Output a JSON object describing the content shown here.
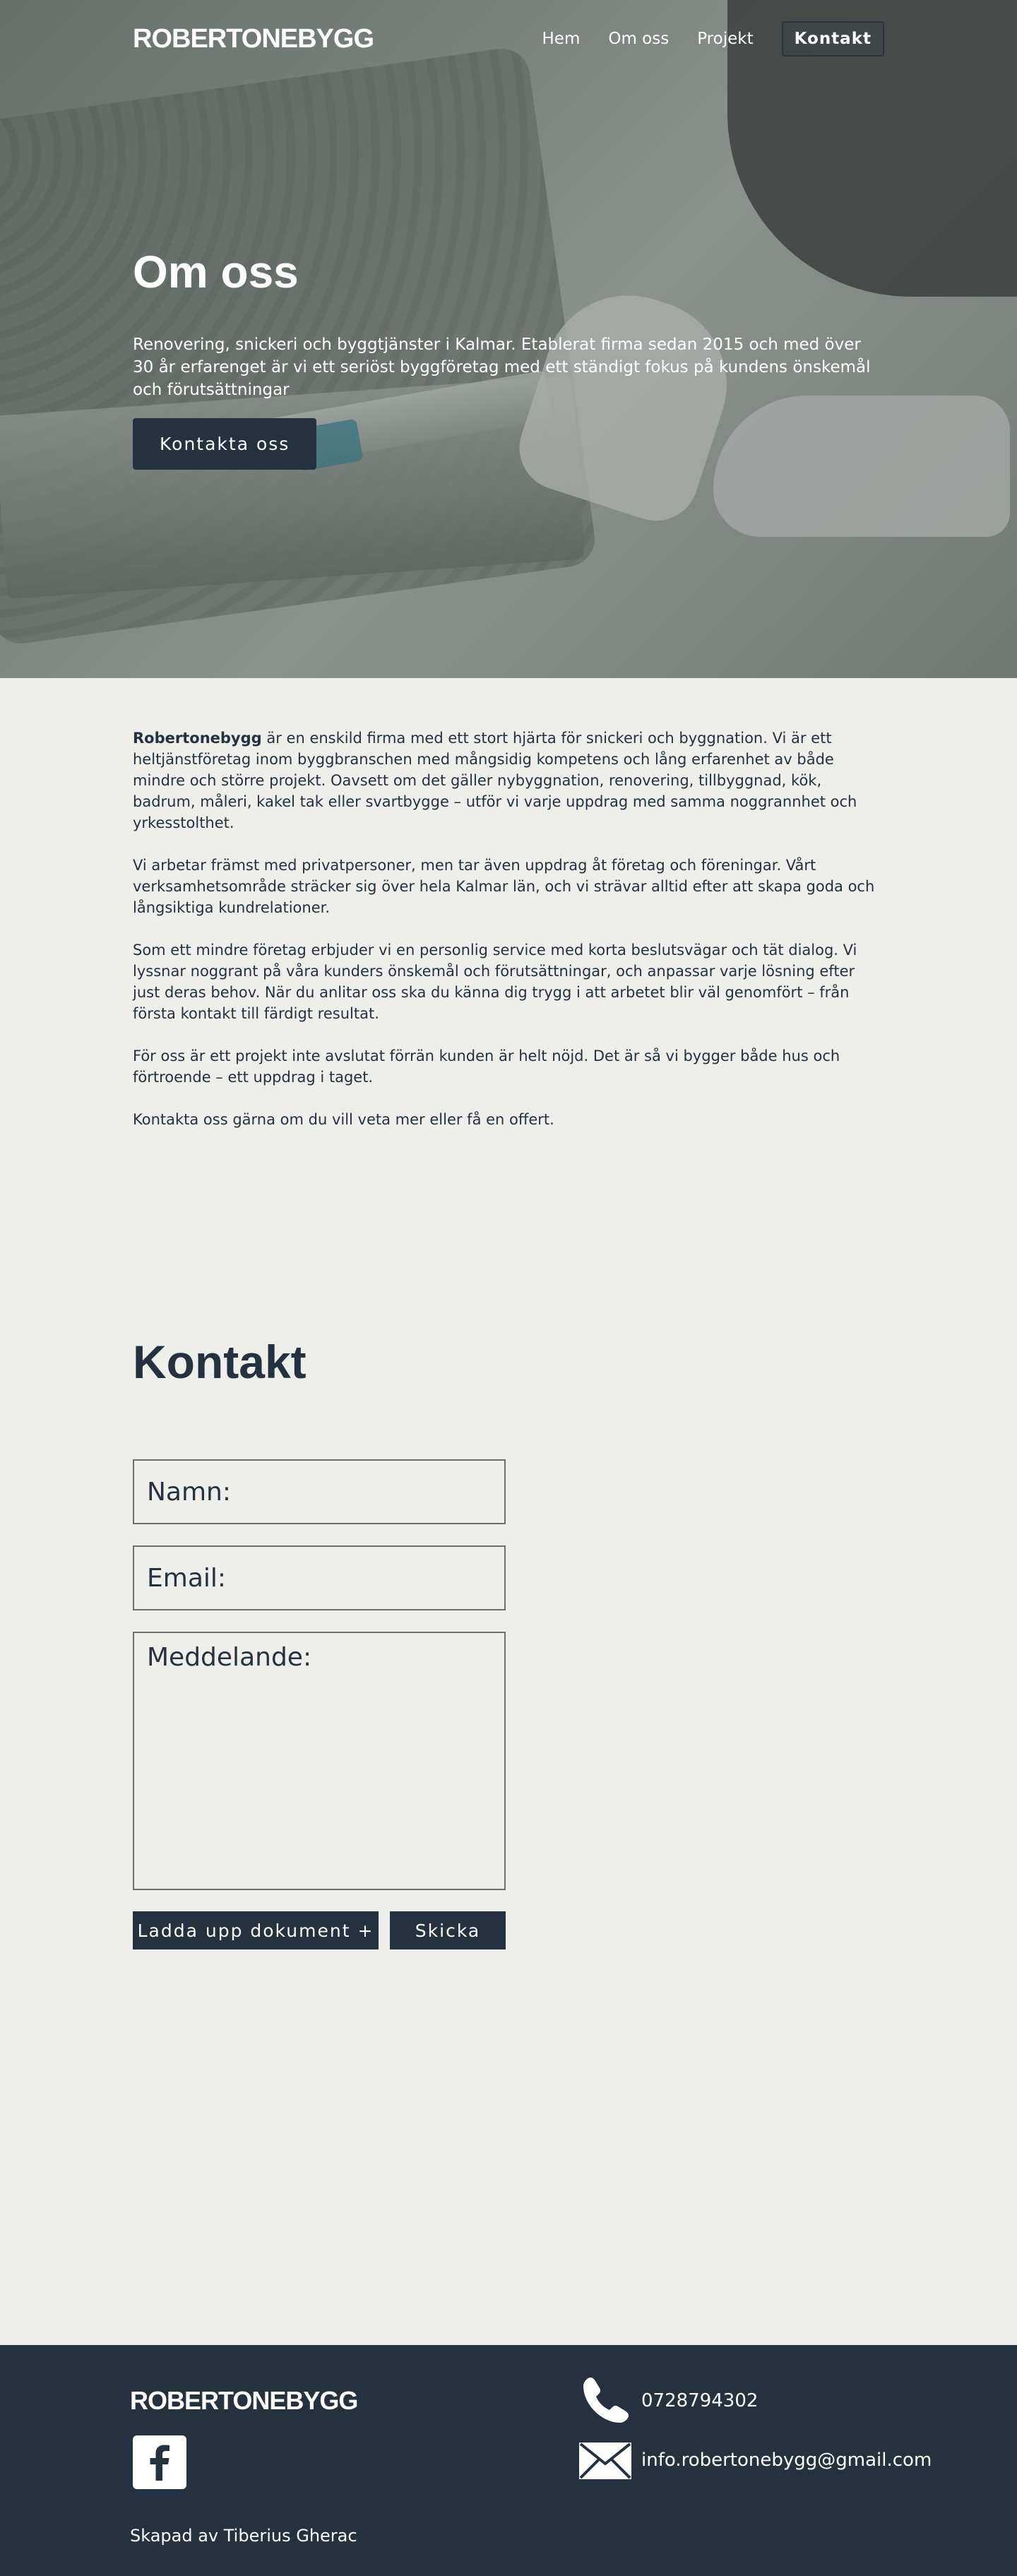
{
  "nav": {
    "logo": "ROBERTONEBYGG",
    "links": [
      "Hem",
      "Om oss",
      "Projekt"
    ],
    "cta": "Kontakt"
  },
  "hero": {
    "title": "Om oss",
    "description": "Renovering, snickeri och byggtjänster i Kalmar. Etablerat firma sedan 2015 och med över 30 år erfarenget är vi ett seriöst byggföretag med ett ständigt fokus på kundens önskemål och förutsättningar",
    "button": "Kontakta oss"
  },
  "about": {
    "company_name": "Robertonebygg",
    "paragraph1_rest": " är en enskild firma med ett stort hjärta för snickeri och byggnation. Vi är ett heltjänstföretag inom byggbranschen med mångsidig kompetens och lång erfarenhet av både mindre och större projekt. Oavsett om det gäller nybyggnation, renovering, tillbyggnad, kök, badrum, måleri, kakel tak eller svartbygge – utför vi varje uppdrag med samma noggrannhet och yrkesstolthet.",
    "paragraph2": "Vi arbetar främst med privatpersoner, men tar även uppdrag åt företag och föreningar. Vårt verksamhetsområde sträcker sig över hela Kalmar län, och vi strävar alltid efter att skapa goda och långsiktiga kundrelationer.",
    "paragraph3": "Som ett mindre företag erbjuder vi en personlig service med korta beslutsvägar och tät dialog. Vi lyssnar noggrant på våra kunders önskemål och förutsättningar, och anpassar varje lösning efter just deras behov. När du anlitar oss ska du känna dig trygg i att arbetet blir väl genomfört – från första kontakt till färdigt resultat.",
    "paragraph4": "För oss är ett projekt inte avslutat förrän kunden är helt nöjd. Det är så vi bygger både hus och förtroende – ett uppdrag i taget.",
    "paragraph5": "Kontakta oss gärna om du vill veta mer eller få en offert."
  },
  "contact": {
    "title": "Kontakt",
    "name_placeholder": "Namn:",
    "email_placeholder": "Email:",
    "message_placeholder": "Meddelande:",
    "upload_button": "Ladda upp dokument +",
    "send_button": "Skicka"
  },
  "footer": {
    "logo": "ROBERTONEBYGG",
    "phone": "0728794302",
    "email": "info.robertonebygg@gmail.com",
    "credit": "Skapad av Tiberius Gherac",
    "icons": [
      "facebook-icon",
      "phone-icon",
      "mail-icon"
    ]
  },
  "colors": {
    "primary": "#263140",
    "background": "#eeefeb",
    "text_light": "#ffffff"
  }
}
